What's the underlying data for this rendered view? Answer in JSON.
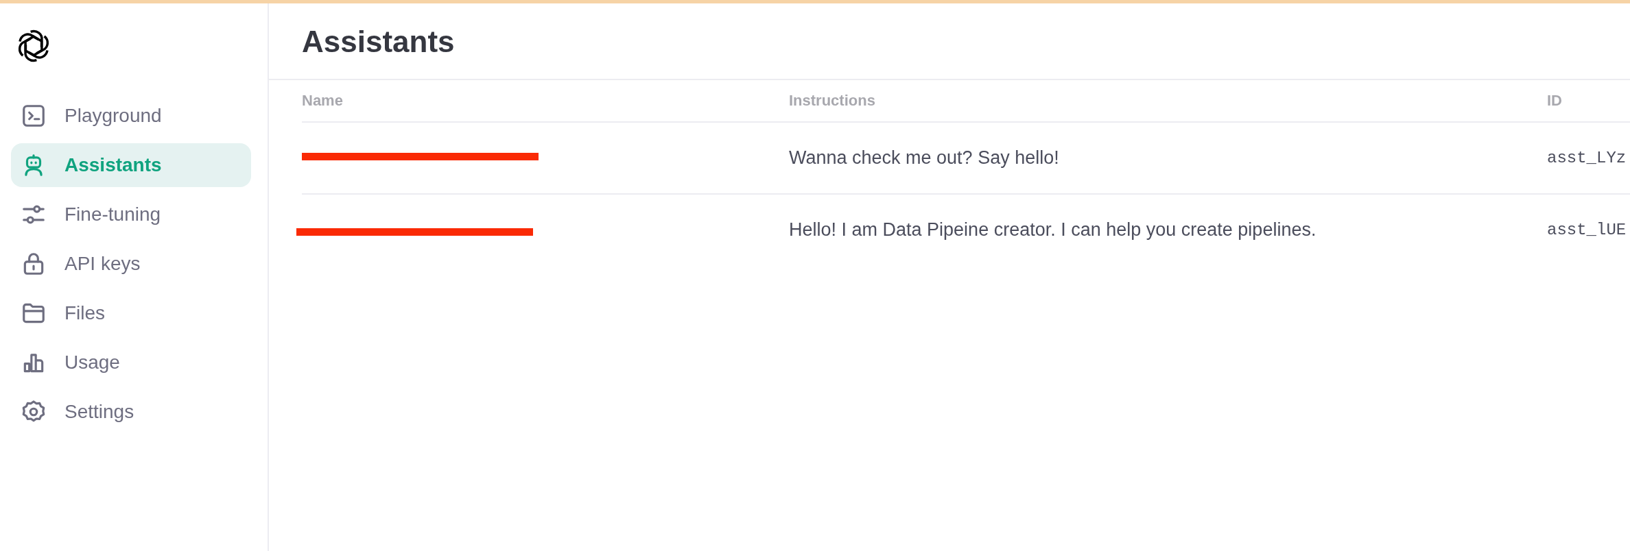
{
  "sidebar": {
    "items": [
      {
        "label": "Playground",
        "kind": "playground",
        "selected": false
      },
      {
        "label": "Assistants",
        "kind": "assistants",
        "selected": true
      },
      {
        "label": "Fine-tuning",
        "kind": "finetuning",
        "selected": false
      },
      {
        "label": "API keys",
        "kind": "apikeys",
        "selected": false
      },
      {
        "label": "Files",
        "kind": "files",
        "selected": false
      },
      {
        "label": "Usage",
        "kind": "usage",
        "selected": false
      },
      {
        "label": "Settings",
        "kind": "settings",
        "selected": false
      }
    ]
  },
  "page": {
    "title": "Assistants"
  },
  "table": {
    "columns": [
      "Name",
      "Instructions",
      "ID"
    ],
    "rows": [
      {
        "redacted": true,
        "instructions": "Wanna check me out? Say hello!",
        "id": "asst_LYz"
      },
      {
        "redacted": true,
        "instructions": "Hello! I am Data Pipeine creator. I can help you create pipelines.",
        "id": "asst_lUE"
      }
    ]
  }
}
